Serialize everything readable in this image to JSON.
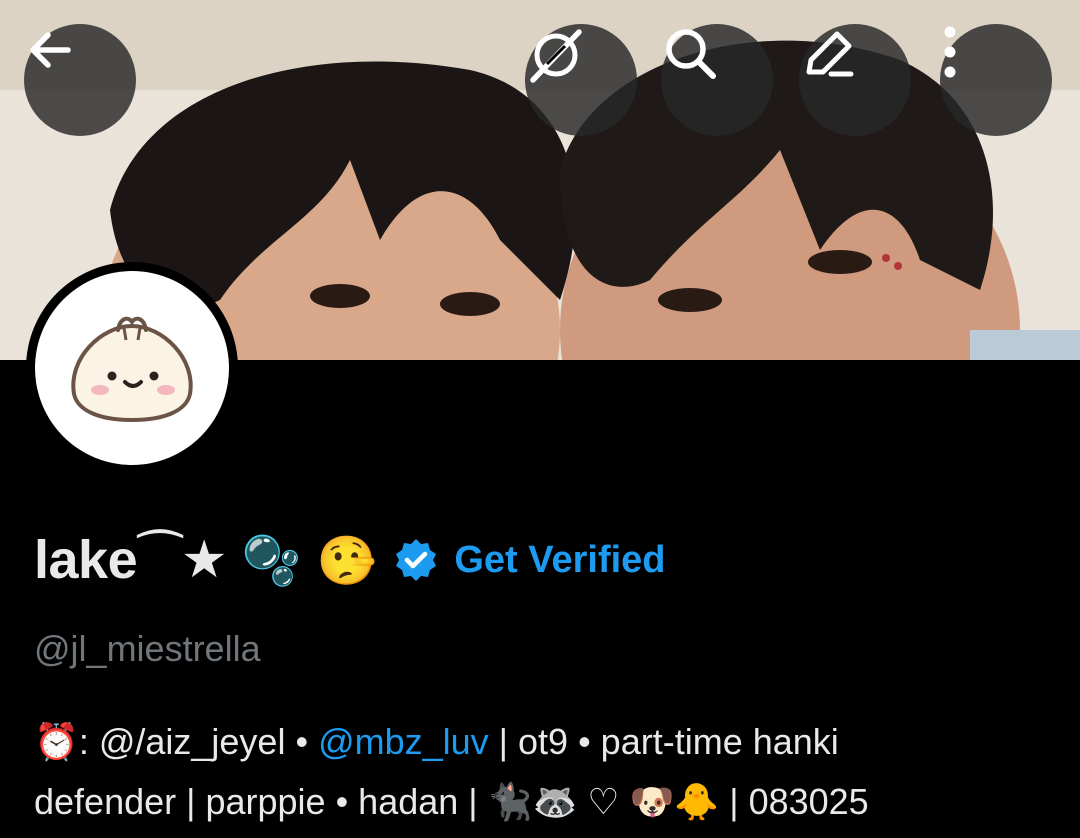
{
  "header": {
    "back_label": "Back",
    "grok_label": "Grok",
    "search_label": "Search",
    "edit_label": "Edit",
    "more_label": "More options"
  },
  "profile": {
    "display_name": "lake",
    "name_decoration": "⁀★",
    "name_emojis": "🫧 🤥",
    "get_verified_label": "Get Verified",
    "handle": "@jl_miestrella",
    "bio": {
      "line1_prefix": "⏰: @/aiz_jeyel • ",
      "mention": "@mbz_luv",
      "line1_suffix": " | ot9 • part-time hanki",
      "line2": "defender | parppie • hadan | 🐈‍⬛🦝 ♡ 🐶🐥 | 083025"
    }
  },
  "colors": {
    "accent": "#1d9bf0",
    "background": "#000000",
    "secondary_text": "#71767b",
    "primary_text": "#e7e9ea"
  }
}
